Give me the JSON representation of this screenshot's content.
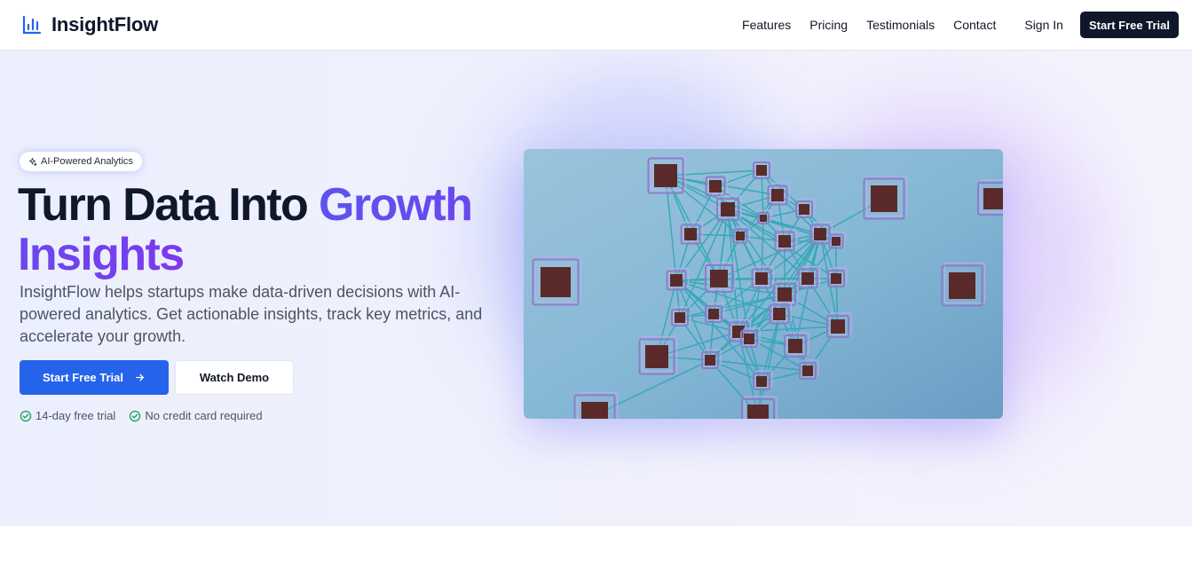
{
  "header": {
    "brand": "InsightFlow",
    "nav": [
      "Features",
      "Pricing",
      "Testimonials",
      "Contact"
    ],
    "sign_in": "Sign In",
    "cta": "Start Free Trial"
  },
  "hero": {
    "badge": "AI-Powered Analytics",
    "headline_part1": "Turn Data Into ",
    "headline_accent": "Growth Insights",
    "description": "InsightFlow helps startups make data-driven decisions with AI-powered analytics. Get actionable insights, track key metrics, and accelerate your growth.",
    "primary_button": "Start Free Trial",
    "secondary_button": "Watch Demo",
    "perks": [
      "14-day free trial",
      "No credit card required"
    ]
  },
  "colors": {
    "primary": "#2563eb",
    "accent_start": "#5b54ef",
    "accent_end": "#7c3aed",
    "dark": "#0f172a",
    "check": "#16a34a"
  },
  "icons": {
    "logo": "bar-chart-icon",
    "badge": "sparkle-icon",
    "primary_button": "arrow-right-icon",
    "perk": "check-circle-icon"
  }
}
